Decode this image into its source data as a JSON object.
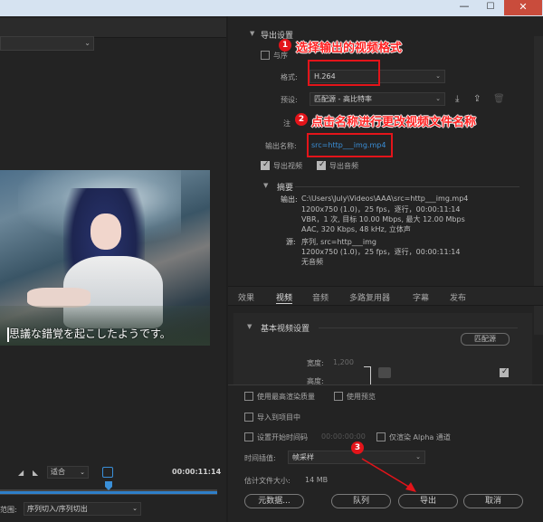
{
  "window": {
    "minimize_glyph": "—",
    "maximize_glyph": "☐",
    "close_glyph": "✕"
  },
  "left": {
    "timecode": "00:00:11:14",
    "fit_value": "适合",
    "range_label": "范围:",
    "range_value": "序列切入/序列切出",
    "subtitle": "思議な錯覚を起こしたようです。",
    "playback_progress": 0.5
  },
  "export_settings": {
    "title": "导出设置",
    "match_sequence_label_partial": "与序",
    "format_label": "格式:",
    "format_value": "H.264",
    "preset_label": "预设:",
    "preset_value": "匹配源 - 高比特率",
    "comment_label_partial": "注",
    "output_name_label": "输出名称:",
    "output_name_value": "src=http___img.mp4",
    "export_video_label": "导出视频",
    "export_video_checked": true,
    "export_audio_label": "导出音频",
    "export_audio_checked": true
  },
  "annotations": [
    {
      "number": "1",
      "text": "选择输出的视频格式"
    },
    {
      "number": "2",
      "text": "点击名称进行更改视频文件名称"
    },
    {
      "number": "3"
    }
  ],
  "summary": {
    "title": "摘要",
    "output_label": "输出:",
    "output_lines": [
      "C:\\Users\\July\\Videos\\AAA\\src=http___img.mp4",
      "1200x750 (1.0)，25 fps，逐行，00:00:11:14",
      "VBR，1 次, 目标 10.00 Mbps, 最大 12.00 Mbps",
      "AAC, 320 Kbps, 48  kHz, 立体声"
    ],
    "source_label": "源:",
    "source_lines": [
      "序列, src=http___img",
      "1200x750 (1.0)，25 fps，逐行，00:00:11:14",
      "无音频"
    ]
  },
  "tabs": [
    {
      "label": "效果",
      "active": false
    },
    {
      "label": "视频",
      "active": true
    },
    {
      "label": "音频",
      "active": false
    },
    {
      "label": "多路复用器",
      "active": false
    },
    {
      "label": "字幕",
      "active": false
    },
    {
      "label": "发布",
      "active": false
    }
  ],
  "video_settings": {
    "section_title": "基本视频设置",
    "match_source_button": "匹配源",
    "width_label": "宽度:",
    "width_value": "1,200",
    "height_label": "高度:"
  },
  "bottom": {
    "max_render_quality": "使用最高渲染质量",
    "use_previews": "使用预览",
    "import_into_project": "导入到项目中",
    "set_start_timecode": "设置开始时间码",
    "start_timecode_value": "00:00:00:00",
    "render_alpha_only": "仅渲染 Alpha 通道",
    "time_interpolation_label": "时间插值:",
    "time_interpolation_value": "帧采样",
    "estimated_size_label": "估计文件大小:",
    "estimated_size_value": "14 MB",
    "metadata_button": "元数据...",
    "queue_button": "队列",
    "export_button": "导出",
    "cancel_button": "取消"
  },
  "colors": {
    "accent_blue": "#3a8fd8",
    "annotation_red": "#e3141a",
    "close_red": "#c94c3c"
  }
}
